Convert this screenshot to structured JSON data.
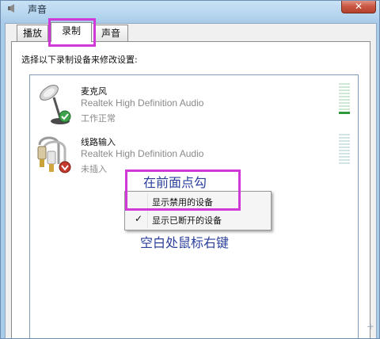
{
  "window": {
    "title": "声音",
    "close_label": "✕"
  },
  "tabs": [
    {
      "label": "播放",
      "active": false
    },
    {
      "label": "录制",
      "active": true
    },
    {
      "label": "声音",
      "active": false
    }
  ],
  "instruction": "选择以下录制设备来修改设置:",
  "devices": [
    {
      "name": "麦克风",
      "driver": "Realtek High Definition Audio",
      "status": "工作正常",
      "icon": "microphone-icon",
      "status_icon": "check-badge-icon"
    },
    {
      "name": "线路输入",
      "driver": "Realtek High Definition Audio",
      "status": "未插入",
      "icon": "line-in-plug-icon",
      "status_icon": "down-arrow-badge-icon"
    }
  ],
  "context_menu": {
    "items": [
      {
        "label": "显示禁用的设备",
        "checked": false
      },
      {
        "label": "显示已断开的设备",
        "checked": true
      }
    ],
    "check_glyph": "✓"
  },
  "annotations": {
    "top": "在前面点勾",
    "bottom": "空白处鼠标右键"
  },
  "colors": {
    "highlight": "#cf3ad6",
    "annotation_text": "#2a3f9a",
    "level_green": "#2e9a3c"
  }
}
